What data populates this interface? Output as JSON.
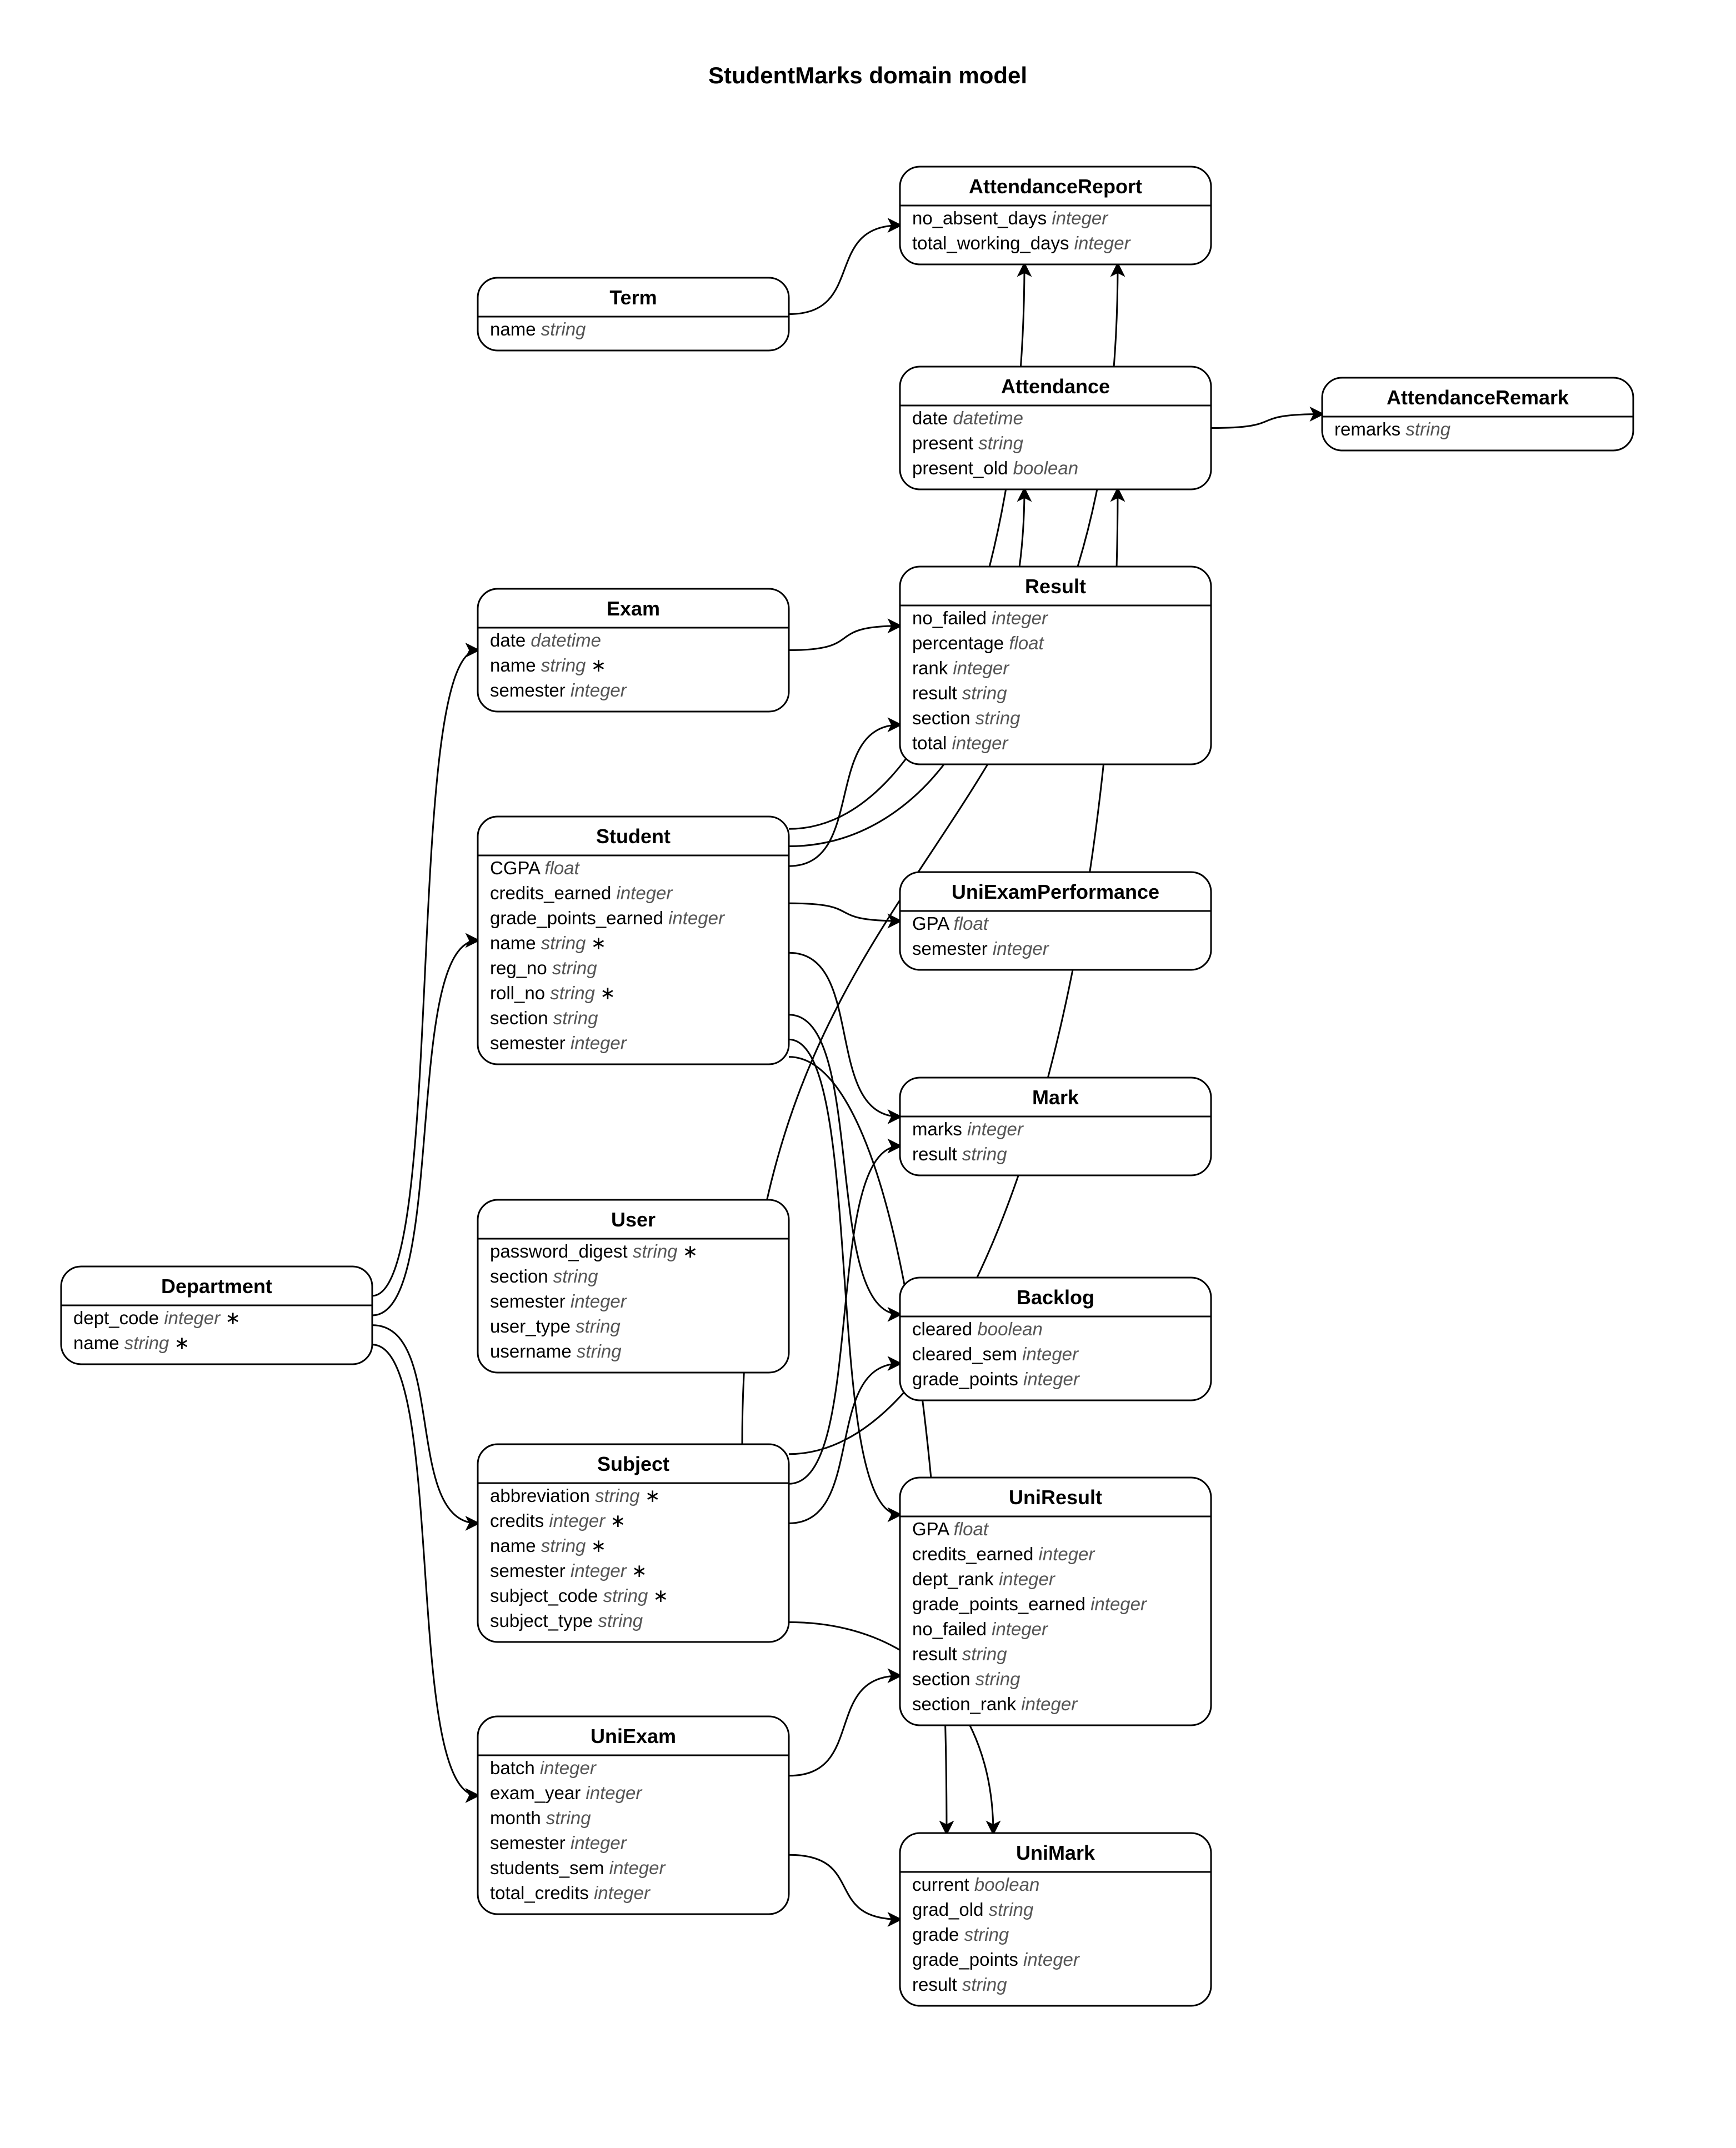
{
  "title": "StudentMarks domain model",
  "entities": {
    "Department": {
      "name": "Department",
      "attrs": [
        [
          "dept_code",
          "integer",
          "*"
        ],
        [
          "name",
          "string",
          "*"
        ]
      ]
    },
    "Term": {
      "name": "Term",
      "attrs": [
        [
          "name",
          "string",
          ""
        ]
      ]
    },
    "Exam": {
      "name": "Exam",
      "attrs": [
        [
          "date",
          "datetime",
          ""
        ],
        [
          "name",
          "string",
          "*"
        ],
        [
          "semester",
          "integer",
          ""
        ]
      ]
    },
    "Student": {
      "name": "Student",
      "attrs": [
        [
          "CGPA",
          "float",
          ""
        ],
        [
          "credits_earned",
          "integer",
          ""
        ],
        [
          "grade_points_earned",
          "integer",
          ""
        ],
        [
          "name",
          "string",
          "*"
        ],
        [
          "reg_no",
          "string",
          ""
        ],
        [
          "roll_no",
          "string",
          "*"
        ],
        [
          "section",
          "string",
          ""
        ],
        [
          "semester",
          "integer",
          ""
        ]
      ]
    },
    "User": {
      "name": "User",
      "attrs": [
        [
          "password_digest",
          "string",
          "*"
        ],
        [
          "section",
          "string",
          ""
        ],
        [
          "semester",
          "integer",
          ""
        ],
        [
          "user_type",
          "string",
          ""
        ],
        [
          "username",
          "string",
          ""
        ]
      ]
    },
    "Subject": {
      "name": "Subject",
      "attrs": [
        [
          "abbreviation",
          "string",
          "*"
        ],
        [
          "credits",
          "integer",
          "*"
        ],
        [
          "name",
          "string",
          "*"
        ],
        [
          "semester",
          "integer",
          "*"
        ],
        [
          "subject_code",
          "string",
          "*"
        ],
        [
          "subject_type",
          "string",
          ""
        ]
      ]
    },
    "UniExam": {
      "name": "UniExam",
      "attrs": [
        [
          "batch",
          "integer",
          ""
        ],
        [
          "exam_year",
          "integer",
          ""
        ],
        [
          "month",
          "string",
          ""
        ],
        [
          "semester",
          "integer",
          ""
        ],
        [
          "students_sem",
          "integer",
          ""
        ],
        [
          "total_credits",
          "integer",
          ""
        ]
      ]
    },
    "AttendanceReport": {
      "name": "AttendanceReport",
      "attrs": [
        [
          "no_absent_days",
          "integer",
          ""
        ],
        [
          "total_working_days",
          "integer",
          ""
        ]
      ]
    },
    "Attendance": {
      "name": "Attendance",
      "attrs": [
        [
          "date",
          "datetime",
          ""
        ],
        [
          "present",
          "string",
          ""
        ],
        [
          "present_old",
          "boolean",
          ""
        ]
      ]
    },
    "AttendanceRemark": {
      "name": "AttendanceRemark",
      "attrs": [
        [
          "remarks",
          "string",
          ""
        ]
      ]
    },
    "Result": {
      "name": "Result",
      "attrs": [
        [
          "no_failed",
          "integer",
          ""
        ],
        [
          "percentage",
          "float",
          ""
        ],
        [
          "rank",
          "integer",
          ""
        ],
        [
          "result",
          "string",
          ""
        ],
        [
          "section",
          "string",
          ""
        ],
        [
          "total",
          "integer",
          ""
        ]
      ]
    },
    "UniExamPerformance": {
      "name": "UniExamPerformance",
      "attrs": [
        [
          "GPA",
          "float",
          ""
        ],
        [
          "semester",
          "integer",
          ""
        ]
      ]
    },
    "Mark": {
      "name": "Mark",
      "attrs": [
        [
          "marks",
          "integer",
          ""
        ],
        [
          "result",
          "string",
          ""
        ]
      ]
    },
    "Backlog": {
      "name": "Backlog",
      "attrs": [
        [
          "cleared",
          "boolean",
          ""
        ],
        [
          "cleared_sem",
          "integer",
          ""
        ],
        [
          "grade_points",
          "integer",
          ""
        ]
      ]
    },
    "UniResult": {
      "name": "UniResult",
      "attrs": [
        [
          "GPA",
          "float",
          ""
        ],
        [
          "credits_earned",
          "integer",
          ""
        ],
        [
          "dept_rank",
          "integer",
          ""
        ],
        [
          "grade_points_earned",
          "integer",
          ""
        ],
        [
          "no_failed",
          "integer",
          ""
        ],
        [
          "result",
          "string",
          ""
        ],
        [
          "section",
          "string",
          ""
        ],
        [
          "section_rank",
          "integer",
          ""
        ]
      ]
    },
    "UniMark": {
      "name": "UniMark",
      "attrs": [
        [
          "current",
          "boolean",
          ""
        ],
        [
          "grad_old",
          "string",
          ""
        ],
        [
          "grade",
          "string",
          ""
        ],
        [
          "grade_points",
          "integer",
          ""
        ],
        [
          "result",
          "string",
          ""
        ]
      ]
    }
  },
  "chart_data": {
    "type": "entity-relationship",
    "title": "StudentMarks domain model",
    "entities": [
      {
        "name": "Department",
        "attributes": [
          {
            "name": "dept_code",
            "type": "integer",
            "required": true
          },
          {
            "name": "name",
            "type": "string",
            "required": true
          }
        ]
      },
      {
        "name": "Term",
        "attributes": [
          {
            "name": "name",
            "type": "string"
          }
        ]
      },
      {
        "name": "Exam",
        "attributes": [
          {
            "name": "date",
            "type": "datetime"
          },
          {
            "name": "name",
            "type": "string",
            "required": true
          },
          {
            "name": "semester",
            "type": "integer"
          }
        ]
      },
      {
        "name": "Student",
        "attributes": [
          {
            "name": "CGPA",
            "type": "float"
          },
          {
            "name": "credits_earned",
            "type": "integer"
          },
          {
            "name": "grade_points_earned",
            "type": "integer"
          },
          {
            "name": "name",
            "type": "string",
            "required": true
          },
          {
            "name": "reg_no",
            "type": "string"
          },
          {
            "name": "roll_no",
            "type": "string",
            "required": true
          },
          {
            "name": "section",
            "type": "string"
          },
          {
            "name": "semester",
            "type": "integer"
          }
        ]
      },
      {
        "name": "User",
        "attributes": [
          {
            "name": "password_digest",
            "type": "string",
            "required": true
          },
          {
            "name": "section",
            "type": "string"
          },
          {
            "name": "semester",
            "type": "integer"
          },
          {
            "name": "user_type",
            "type": "string"
          },
          {
            "name": "username",
            "type": "string"
          }
        ]
      },
      {
        "name": "Subject",
        "attributes": [
          {
            "name": "abbreviation",
            "type": "string",
            "required": true
          },
          {
            "name": "credits",
            "type": "integer",
            "required": true
          },
          {
            "name": "name",
            "type": "string",
            "required": true
          },
          {
            "name": "semester",
            "type": "integer",
            "required": true
          },
          {
            "name": "subject_code",
            "type": "string",
            "required": true
          },
          {
            "name": "subject_type",
            "type": "string"
          }
        ]
      },
      {
        "name": "UniExam",
        "attributes": [
          {
            "name": "batch",
            "type": "integer"
          },
          {
            "name": "exam_year",
            "type": "integer"
          },
          {
            "name": "month",
            "type": "string"
          },
          {
            "name": "semester",
            "type": "integer"
          },
          {
            "name": "students_sem",
            "type": "integer"
          },
          {
            "name": "total_credits",
            "type": "integer"
          }
        ]
      },
      {
        "name": "AttendanceReport",
        "attributes": [
          {
            "name": "no_absent_days",
            "type": "integer"
          },
          {
            "name": "total_working_days",
            "type": "integer"
          }
        ]
      },
      {
        "name": "Attendance",
        "attributes": [
          {
            "name": "date",
            "type": "datetime"
          },
          {
            "name": "present",
            "type": "string"
          },
          {
            "name": "present_old",
            "type": "boolean"
          }
        ]
      },
      {
        "name": "AttendanceRemark",
        "attributes": [
          {
            "name": "remarks",
            "type": "string"
          }
        ]
      },
      {
        "name": "Result",
        "attributes": [
          {
            "name": "no_failed",
            "type": "integer"
          },
          {
            "name": "percentage",
            "type": "float"
          },
          {
            "name": "rank",
            "type": "integer"
          },
          {
            "name": "result",
            "type": "string"
          },
          {
            "name": "section",
            "type": "string"
          },
          {
            "name": "total",
            "type": "integer"
          }
        ]
      },
      {
        "name": "UniExamPerformance",
        "attributes": [
          {
            "name": "GPA",
            "type": "float"
          },
          {
            "name": "semester",
            "type": "integer"
          }
        ]
      },
      {
        "name": "Mark",
        "attributes": [
          {
            "name": "marks",
            "type": "integer"
          },
          {
            "name": "result",
            "type": "string"
          }
        ]
      },
      {
        "name": "Backlog",
        "attributes": [
          {
            "name": "cleared",
            "type": "boolean"
          },
          {
            "name": "cleared_sem",
            "type": "integer"
          },
          {
            "name": "grade_points",
            "type": "integer"
          }
        ]
      },
      {
        "name": "UniResult",
        "attributes": [
          {
            "name": "GPA",
            "type": "float"
          },
          {
            "name": "credits_earned",
            "type": "integer"
          },
          {
            "name": "dept_rank",
            "type": "integer"
          },
          {
            "name": "grade_points_earned",
            "type": "integer"
          },
          {
            "name": "no_failed",
            "type": "integer"
          },
          {
            "name": "result",
            "type": "string"
          },
          {
            "name": "section",
            "type": "string"
          },
          {
            "name": "section_rank",
            "type": "integer"
          }
        ]
      },
      {
        "name": "UniMark",
        "attributes": [
          {
            "name": "current",
            "type": "boolean"
          },
          {
            "name": "grad_old",
            "type": "string"
          },
          {
            "name": "grade",
            "type": "string"
          },
          {
            "name": "grade_points",
            "type": "integer"
          },
          {
            "name": "result",
            "type": "string"
          }
        ]
      }
    ],
    "relationships": [
      {
        "from": "Department",
        "to": "Exam"
      },
      {
        "from": "Department",
        "to": "Student"
      },
      {
        "from": "Department",
        "to": "Subject"
      },
      {
        "from": "Department",
        "to": "UniExam"
      },
      {
        "from": "Term",
        "to": "AttendanceReport"
      },
      {
        "from": "Exam",
        "to": "Result"
      },
      {
        "from": "Student",
        "to": "AttendanceReport"
      },
      {
        "from": "Student",
        "to": "Attendance"
      },
      {
        "from": "Student",
        "to": "Result"
      },
      {
        "from": "Student",
        "to": "UniExamPerformance"
      },
      {
        "from": "Student",
        "to": "Mark"
      },
      {
        "from": "Student",
        "to": "Backlog"
      },
      {
        "from": "Student",
        "to": "UniResult"
      },
      {
        "from": "Student",
        "to": "UniMark"
      },
      {
        "from": "Subject",
        "to": "AttendanceReport"
      },
      {
        "from": "Subject",
        "to": "Attendance"
      },
      {
        "from": "Subject",
        "to": "Mark"
      },
      {
        "from": "Subject",
        "to": "Backlog"
      },
      {
        "from": "Subject",
        "to": "UniMark"
      },
      {
        "from": "UniExam",
        "to": "UniResult"
      },
      {
        "from": "UniExam",
        "to": "UniMark"
      },
      {
        "from": "Attendance",
        "to": "AttendanceRemark"
      }
    ]
  }
}
